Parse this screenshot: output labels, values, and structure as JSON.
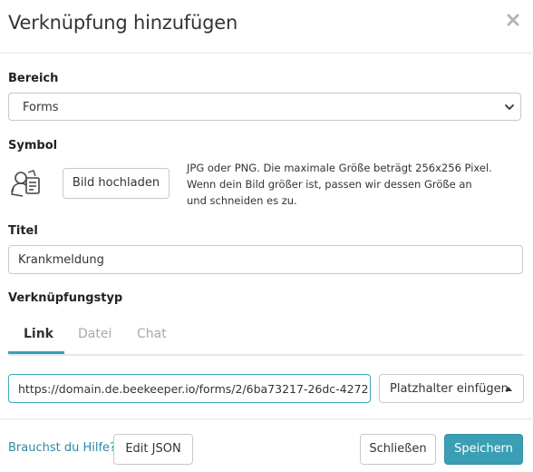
{
  "header": {
    "title": "Verknüpfung hinzufügen",
    "close_icon": "close-icon"
  },
  "bereich": {
    "label": "Bereich",
    "selected": "Forms"
  },
  "symbol": {
    "label": "Symbol",
    "icon": "forms-person-icon",
    "upload_label": "Bild hochladen",
    "hint": "JPG oder PNG. Die maximale Größe beträgt 256x256 Pixel. Wenn dein Bild größer ist, passen wir dessen Größe an und schneiden es zu."
  },
  "titel": {
    "label": "Titel",
    "value": "Krankmeldung"
  },
  "link_type": {
    "label": "Verknüpfungstyp",
    "tabs": [
      {
        "label": "Link",
        "active": true
      },
      {
        "label": "Datei",
        "active": false
      },
      {
        "label": "Chat",
        "active": false
      }
    ],
    "url_value": "https://domain.de.beekeeper.io/forms/2/6ba73217-26dc-4272",
    "placeholder_button": "Platzhalter einfügen"
  },
  "footer": {
    "help_link": "Brauchst du Hilfe?",
    "edit_json": "Edit JSON",
    "close": "Schließen",
    "save": "Speichern"
  },
  "colors": {
    "accent": "#3a9fb4",
    "link": "#2b8aa3",
    "border": "#c8c8c8"
  }
}
